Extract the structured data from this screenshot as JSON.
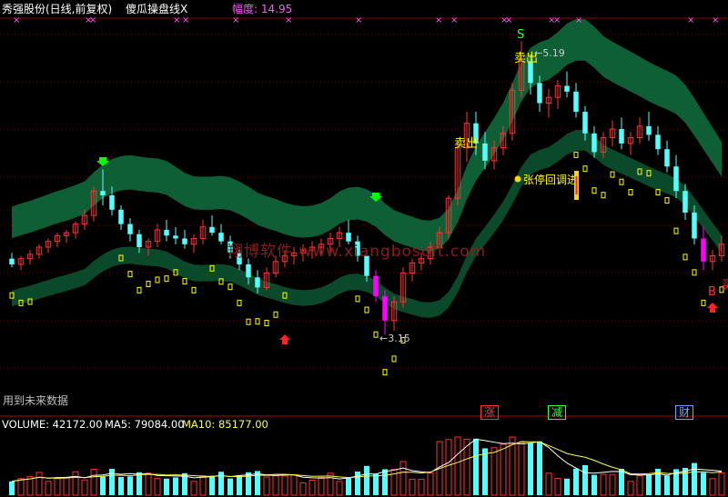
{
  "header": {
    "stock": "秀强股份(日线,前复权)",
    "indicator": "傻瓜操盘线X",
    "amplitude": "幅度: 14.95"
  },
  "volume_header": {
    "volume": "VOLUME: 42172.00",
    "ma5": "MA5: 79084.00",
    "ma10": "MA10: 85177.00"
  },
  "labels": {
    "future_note": "用到未来数据",
    "watermark": "翔博软件 www.xiangbosoft.com",
    "high_price": "5.19",
    "low_price": "3.15",
    "sell_label_1": "S",
    "sell_label_2": "卖出",
    "sell_label_3": "卖出",
    "buy_label": "B",
    "buy_label_cut": "买",
    "limit_pullback": "张停回调进",
    "tag_up": "涨",
    "tag_down": "减",
    "tag_finance": "财"
  },
  "colors": {
    "up_candle": "#ff3333",
    "down_candle": "#54ffff",
    "band": "#0e5f35",
    "band_low": "#0a4a2a",
    "yellow_box": "#ffff00",
    "magenta": "#ff00ff",
    "green_arrow": "#00ff00",
    "red_arrow": "#ff2222",
    "pullback_yellow": "#ffd700"
  },
  "chart_data": {
    "type": "candlestick",
    "price_range": [
      2.7,
      5.35
    ],
    "ohlc": [
      [
        3.68,
        3.72,
        3.62,
        3.64
      ],
      [
        3.64,
        3.7,
        3.6,
        3.68
      ],
      [
        3.68,
        3.74,
        3.64,
        3.71
      ],
      [
        3.71,
        3.78,
        3.68,
        3.76
      ],
      [
        3.76,
        3.82,
        3.72,
        3.8
      ],
      [
        3.8,
        3.86,
        3.76,
        3.84
      ],
      [
        3.84,
        3.88,
        3.79,
        3.86
      ],
      [
        3.86,
        3.94,
        3.82,
        3.92
      ],
      [
        3.92,
        4.02,
        3.88,
        3.98
      ],
      [
        3.98,
        4.18,
        3.94,
        4.15
      ],
      [
        4.15,
        4.3,
        4.05,
        4.12
      ],
      [
        4.12,
        4.18,
        3.98,
        4.02
      ],
      [
        4.02,
        4.05,
        3.88,
        3.92
      ],
      [
        3.92,
        3.96,
        3.8,
        3.85
      ],
      [
        3.85,
        3.88,
        3.72,
        3.76
      ],
      [
        3.76,
        3.82,
        3.7,
        3.8
      ],
      [
        3.8,
        3.92,
        3.76,
        3.88
      ],
      [
        3.88,
        3.95,
        3.8,
        3.84
      ],
      [
        3.84,
        3.9,
        3.78,
        3.82
      ],
      [
        3.82,
        3.88,
        3.75,
        3.78
      ],
      [
        3.78,
        3.85,
        3.72,
        3.82
      ],
      [
        3.82,
        3.95,
        3.78,
        3.9
      ],
      [
        3.9,
        3.98,
        3.84,
        3.86
      ],
      [
        3.86,
        3.92,
        3.78,
        3.8
      ],
      [
        3.8,
        3.84,
        3.68,
        3.72
      ],
      [
        3.72,
        3.76,
        3.6,
        3.64
      ],
      [
        3.64,
        3.68,
        3.5,
        3.55
      ],
      [
        3.55,
        3.6,
        3.44,
        3.48
      ],
      [
        3.48,
        3.62,
        3.46,
        3.58
      ],
      [
        3.58,
        3.7,
        3.55,
        3.66
      ],
      [
        3.66,
        3.74,
        3.62,
        3.7
      ],
      [
        3.7,
        3.76,
        3.64,
        3.72
      ],
      [
        3.72,
        3.78,
        3.66,
        3.74
      ],
      [
        3.74,
        3.8,
        3.68,
        3.76
      ],
      [
        3.76,
        3.82,
        3.7,
        3.78
      ],
      [
        3.78,
        3.86,
        3.72,
        3.82
      ],
      [
        3.82,
        3.9,
        3.76,
        3.86
      ],
      [
        3.86,
        3.95,
        3.78,
        3.8
      ],
      [
        3.8,
        3.84,
        3.66,
        3.7
      ],
      [
        3.7,
        3.74,
        3.52,
        3.56
      ],
      [
        3.56,
        3.6,
        3.38,
        3.42
      ],
      [
        3.42,
        3.46,
        3.15,
        3.25
      ],
      [
        3.25,
        3.42,
        3.18,
        3.38
      ],
      [
        3.38,
        3.62,
        3.34,
        3.58
      ],
      [
        3.58,
        3.68,
        3.52,
        3.65
      ],
      [
        3.65,
        3.72,
        3.6,
        3.68
      ],
      [
        3.68,
        3.8,
        3.64,
        3.76
      ],
      [
        3.76,
        3.9,
        3.72,
        3.86
      ],
      [
        3.86,
        4.12,
        3.82,
        4.1
      ],
      [
        4.1,
        4.5,
        4.05,
        4.45
      ],
      [
        4.45,
        4.7,
        4.35,
        4.62
      ],
      [
        4.62,
        4.7,
        4.4,
        4.48
      ],
      [
        4.48,
        4.56,
        4.3,
        4.36
      ],
      [
        4.36,
        4.5,
        4.3,
        4.45
      ],
      [
        4.45,
        4.6,
        4.4,
        4.55
      ],
      [
        4.55,
        4.9,
        4.5,
        4.85
      ],
      [
        4.85,
        5.19,
        4.8,
        5.05
      ],
      [
        5.05,
        5.1,
        4.82,
        4.9
      ],
      [
        4.9,
        4.95,
        4.7,
        4.76
      ],
      [
        4.76,
        4.86,
        4.66,
        4.8
      ],
      [
        4.8,
        4.92,
        4.72,
        4.88
      ],
      [
        4.88,
        4.98,
        4.8,
        4.84
      ],
      [
        4.84,
        4.9,
        4.66,
        4.7
      ],
      [
        4.7,
        4.74,
        4.5,
        4.55
      ],
      [
        4.55,
        4.6,
        4.38,
        4.42
      ],
      [
        4.42,
        4.56,
        4.38,
        4.52
      ],
      [
        4.52,
        4.64,
        4.46,
        4.58
      ],
      [
        4.58,
        4.66,
        4.44,
        4.48
      ],
      [
        4.48,
        4.56,
        4.4,
        4.52
      ],
      [
        4.52,
        4.66,
        4.48,
        4.6
      ],
      [
        4.6,
        4.7,
        4.5,
        4.54
      ],
      [
        4.54,
        4.6,
        4.4,
        4.44
      ],
      [
        4.44,
        4.5,
        4.28,
        4.32
      ],
      [
        4.32,
        4.4,
        4.1,
        4.15
      ],
      [
        4.15,
        4.2,
        3.95,
        4.0
      ],
      [
        4.0,
        4.05,
        3.78,
        3.82
      ],
      [
        3.82,
        3.9,
        3.6,
        3.66
      ],
      [
        3.66,
        3.74,
        3.6,
        3.7
      ],
      [
        3.7,
        3.84,
        3.66,
        3.78
      ]
    ]
  }
}
